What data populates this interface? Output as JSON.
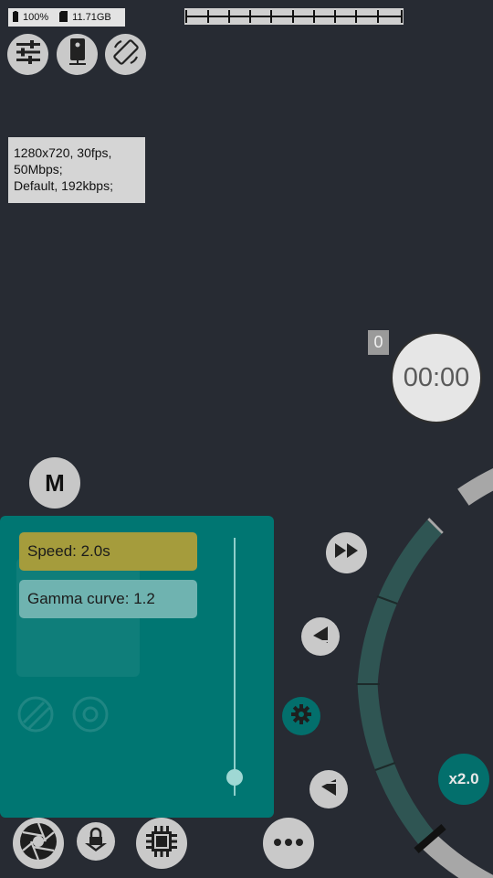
{
  "status": {
    "battery": "100%",
    "storage": "11.71GB"
  },
  "toolbar": {
    "icons": [
      "sliders-icon",
      "phone-record-icon",
      "rotate-screen-icon"
    ]
  },
  "info": {
    "line1": "1280x720, 30fps,",
    "line2": "50Mbps;",
    "line3": "Default, 192kbps;"
  },
  "record": {
    "counter": "0",
    "timer": "00:00"
  },
  "mode": {
    "label": "M"
  },
  "panel": {
    "speed_label": "Speed: 2.0s",
    "gamma_label": "Gamma curve: 1.2"
  },
  "zoom": {
    "label": "x2.0"
  },
  "colors": {
    "background": "#272b33",
    "panel": "#007672",
    "speed_chip": "#a59c3c",
    "gamma_chip": "#6fb3b0",
    "dial_active": "#2f5553",
    "dial_track": "#a7a7a7"
  }
}
